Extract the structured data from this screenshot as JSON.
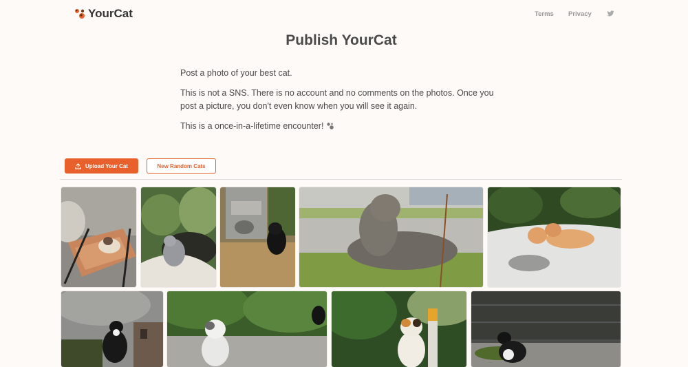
{
  "header": {
    "brand": "YourCat",
    "nav": {
      "terms": "Terms",
      "privacy": "Privacy",
      "twitter_icon": "twitter-icon"
    }
  },
  "main": {
    "title": "Publish YourCat",
    "paragraphs": [
      "Post a photo of your best cat.",
      "This is not a SNS. There is no account and no comments on the photos. Once you post a picture, you don't even know when you will see it again.",
      "This is a once-in-a-lifetime encounter!"
    ]
  },
  "actions": {
    "upload_label": "Upload Your Cat",
    "random_label": "New Random Cats"
  },
  "colors": {
    "accent": "#e8602c",
    "background": "#fdfaf7",
    "text": "#4a4a4a"
  },
  "gallery": {
    "photos": [
      {
        "subject": "siamese-cat-on-chair"
      },
      {
        "subject": "gray-cat-walking-by-plants"
      },
      {
        "subject": "black-cat-by-shrine"
      },
      {
        "subject": "gray-tabby-lying-on-grass"
      },
      {
        "subject": "two-orange-kittens-on-snow"
      },
      {
        "subject": "tuxedo-cat-by-building"
      },
      {
        "subject": "white-gray-cat-by-wall"
      },
      {
        "subject": "calico-cat-in-garden"
      },
      {
        "subject": "tuxedo-cat-by-fence"
      }
    ]
  }
}
